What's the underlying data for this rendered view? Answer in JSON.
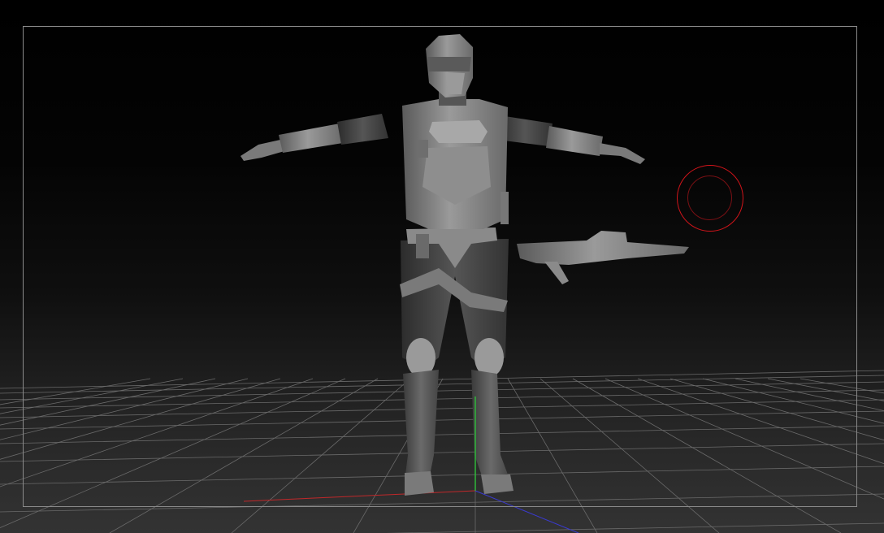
{
  "viewport": {
    "background_top": "#000000",
    "background_bottom": "#333333",
    "grid_color": "#6a6a6a",
    "frame_color": "#8a8a8a"
  },
  "axes": {
    "x_color": "#c0282a",
    "y_color": "#2fb83a",
    "z_color": "#3a3ad0"
  },
  "model": {
    "material_color": "#8c8c8c",
    "icon": "character-sculpt-model"
  },
  "weapon": {
    "icon": "rifle-subtool"
  },
  "brush": {
    "outer_color": "#d0141a",
    "inner_color": "#7a1014",
    "icon": "brush-cursor-icon"
  }
}
